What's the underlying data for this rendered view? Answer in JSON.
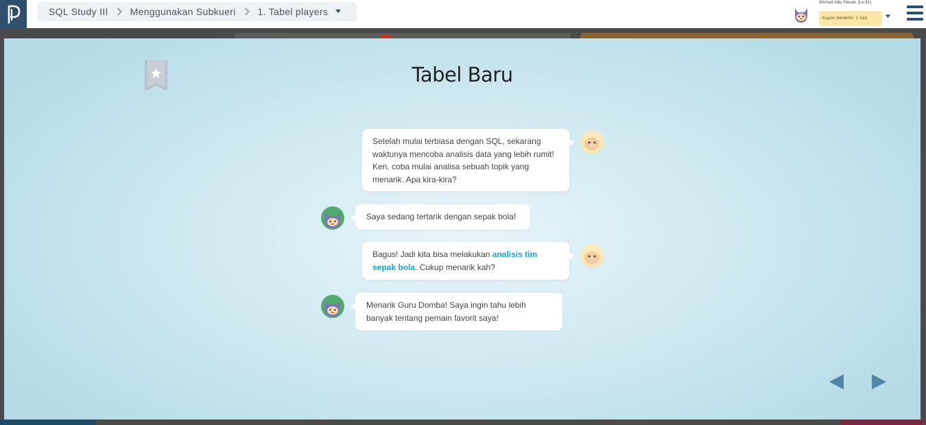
{
  "breadcrumb": {
    "course": "SQL Study III",
    "chapter": "Menggunakan Subkueri",
    "lesson": "1. Tabel players"
  },
  "user": {
    "name": "Ahmad Abu Hasan (Lv.91)",
    "coupon": "Kupon berakhir: 1 hari"
  },
  "slide": {
    "title": "Tabel Baru",
    "messages": [
      {
        "speaker": "teacher",
        "text": "Setelah mulai terbiasa dengan SQL, sekarang waktunya mencoba analisis data yang lebih rumit! Ken, coba mulai analisa sebuah topik yang menarik. Apa kira-kira?"
      },
      {
        "speaker": "student",
        "text": "Saya sedang tertarik dengan sepak bola!"
      },
      {
        "speaker": "teacher",
        "text_before": "Bagus! Jadi kita bisa melakukan ",
        "highlight": "analisis tim sepak bola",
        "text_after": ". Cukup menarik kah?"
      },
      {
        "speaker": "student",
        "text": "Menarik Guru Domba! Saya ingin tahu lebih banyak tentang pemain favorit saya!"
      }
    ]
  },
  "colors": {
    "brand": "#2f4f6f",
    "highlight": "#1aa3d9",
    "arrow": "#4f86a8",
    "coupon_bg": "#fde7a8"
  },
  "icons": {
    "logo": "progate-logo-icon",
    "bookmark": "bookmark-star-icon",
    "prev": "triangle-left-icon",
    "next": "triangle-right-icon"
  }
}
